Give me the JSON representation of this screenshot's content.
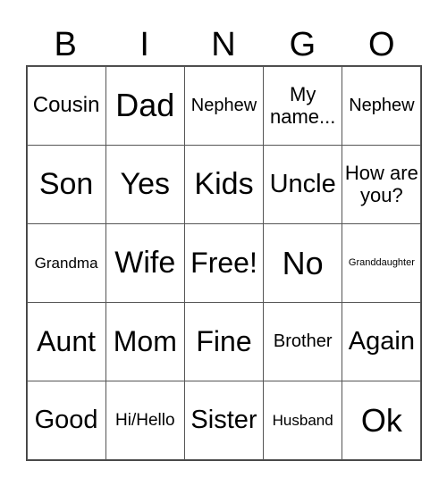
{
  "header": {
    "letters": [
      "B",
      "I",
      "N",
      "G",
      "O"
    ]
  },
  "cells": [
    [
      "Cousin",
      "Dad",
      "Nephew",
      "My name...",
      "Nephew"
    ],
    [
      "Son",
      "Yes",
      "Kids",
      "Uncle",
      "How are you?"
    ],
    [
      "Grandma",
      "Wife",
      "Free!",
      "No",
      "Granddaughter"
    ],
    [
      "Aunt",
      "Mom",
      "Fine",
      "Brother",
      "Again"
    ],
    [
      "Good",
      "Hi/Hello",
      "Sister",
      "Husband",
      "Ok"
    ]
  ]
}
